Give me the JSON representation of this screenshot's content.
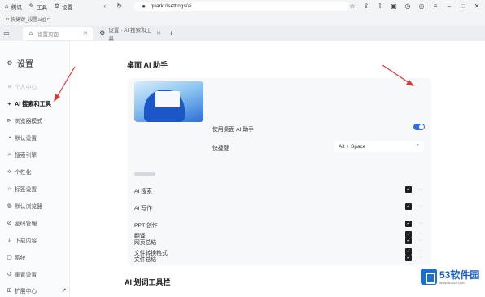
{
  "topbar": {
    "items": [
      "腾讯",
      "工具",
      "设置"
    ],
    "address": "quark://settings/ai"
  },
  "subbar": {
    "text": "ㅁ 快捷键_设置ai@ㅁ"
  },
  "tabs": [
    {
      "label": "设置页面"
    },
    {
      "label": "设置 · AI 搜索和工具"
    }
  ],
  "sidebar": {
    "title": "设置",
    "items": [
      {
        "label": "个人中心",
        "icon": "user-icon"
      },
      {
        "label": "AI 搜索和工具",
        "icon": "ai-icon"
      },
      {
        "label": "浏览器模式",
        "icon": "browser-icon"
      },
      {
        "label": "默认设置",
        "icon": "default-icon"
      },
      {
        "label": "搜索引擎",
        "icon": "search-icon"
      },
      {
        "label": "个性化",
        "icon": "palette-icon"
      },
      {
        "label": "标签设置",
        "icon": "tag-icon"
      },
      {
        "label": "默认浏览器",
        "icon": "globe-icon"
      },
      {
        "label": "密码管理",
        "icon": "key-icon"
      },
      {
        "label": "下载内容",
        "icon": "download-icon"
      },
      {
        "label": "系统",
        "icon": "system-icon"
      },
      {
        "label": "重置设置",
        "icon": "reset-icon"
      },
      {
        "label": "扩展中心",
        "icon": "extension-icon"
      }
    ]
  },
  "main": {
    "title": "桌面 AI 助手",
    "enable_label": "使用桌面 AI 助手",
    "enabled": true,
    "shortcut_label": "快捷键",
    "shortcut_value": "Alt + Space",
    "features": [
      {
        "label": "AI 搜索",
        "checked": true
      },
      {
        "label": "AI 写作",
        "checked": true
      },
      {
        "label": "PPT 创作",
        "checked": true
      },
      {
        "label": "网页总结",
        "checked": true
      },
      {
        "label": "文件总结",
        "checked": true
      },
      {
        "label": "翻译",
        "checked": true
      },
      {
        "label": "文件转换格式",
        "checked": true
      }
    ],
    "section2_title": "AI 划词工具栏"
  },
  "watermark": {
    "name": "53软件园",
    "url": "www.53sof.com"
  },
  "colors": {
    "accent": "#2f6fe4",
    "arrow": "#d63a3a"
  }
}
